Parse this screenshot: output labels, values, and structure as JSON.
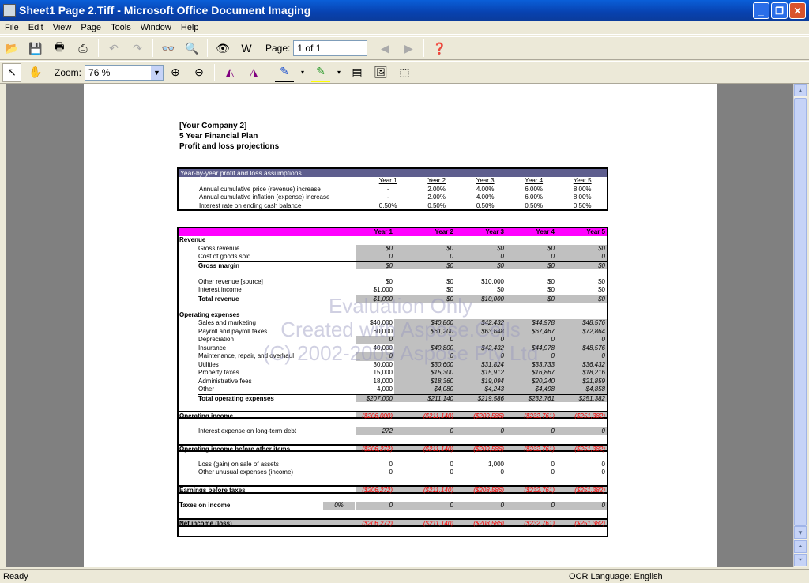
{
  "window": {
    "title": "Sheet1 Page 2.Tiff - Microsoft Office Document Imaging",
    "minimize": "_",
    "maximize": "❐",
    "close": "✕"
  },
  "menu": [
    "File",
    "Edit",
    "View",
    "Page",
    "Tools",
    "Window",
    "Help"
  ],
  "toolbar": {
    "page_label": "Page:",
    "page_value": "1 of 1",
    "zoom_label": "Zoom:",
    "zoom_value": "76 %"
  },
  "status": {
    "left": "Ready",
    "ocr": "OCR Language: English"
  },
  "document": {
    "header": [
      "[Your Company 2]",
      "5 Year Financial Plan",
      "Profit and loss projections"
    ],
    "assumptions": {
      "title": "Year-by-year profit and loss assumptions",
      "years": [
        "Year 1",
        "Year 2",
        "Year 3",
        "Year 4",
        "Year 5"
      ],
      "rows": [
        {
          "label": "Annual cumulative price (revenue) increase",
          "values": [
            "-",
            "2.00%",
            "4.00%",
            "6.00%",
            "8.00%"
          ]
        },
        {
          "label": "Annual cumulative inflation (expense) increase",
          "values": [
            "-",
            "2.00%",
            "4.00%",
            "6.00%",
            "8.00%"
          ]
        },
        {
          "label": "Interest rate on ending cash balance",
          "values": [
            "0.50%",
            "0.50%",
            "0.50%",
            "0.50%",
            "0.50%"
          ]
        }
      ]
    },
    "pl": {
      "years": [
        "Year 1",
        "Year 2",
        "Year 3",
        "Year 4",
        "Year 5"
      ],
      "rows": [
        {
          "kind": "section",
          "label": "Revenue"
        },
        {
          "kind": "shaded",
          "label": "Gross revenue",
          "values": [
            "$0",
            "$0",
            "$0",
            "$0",
            "$0"
          ]
        },
        {
          "kind": "shaded",
          "label": "Cost of goods sold",
          "values": [
            "0",
            "0",
            "0",
            "0",
            "0"
          ]
        },
        {
          "kind": "subtotal",
          "label": "Gross margin",
          "values": [
            "$0",
            "$0",
            "$0",
            "$0",
            "$0"
          ]
        },
        {
          "kind": "blank"
        },
        {
          "kind": "plain",
          "label": "Other revenue [source]",
          "values": [
            "$0",
            "$0",
            "$10,000",
            "$0",
            "$0"
          ]
        },
        {
          "kind": "plain",
          "label": "Interest income",
          "values": [
            "$1,000",
            "$0",
            "$0",
            "$0",
            "$0"
          ]
        },
        {
          "kind": "subtotal",
          "label": "Total revenue",
          "values": [
            "$1,000",
            "$0",
            "$10,000",
            "$0",
            "$0"
          ]
        },
        {
          "kind": "blank"
        },
        {
          "kind": "section",
          "label": "Operating expenses"
        },
        {
          "kind": "input",
          "label": "Sales and marketing",
          "values": [
            "$40,000",
            "$40,800",
            "$42,432",
            "$44,978",
            "$48,576"
          ]
        },
        {
          "kind": "input",
          "label": "Payroll and payroll taxes",
          "values": [
            "60,000",
            "$61,200",
            "$63,648",
            "$67,467",
            "$72,864"
          ]
        },
        {
          "kind": "shaded",
          "label": "Depreciation",
          "values": [
            "0",
            "0",
            "0",
            "0",
            "0"
          ]
        },
        {
          "kind": "input",
          "label": "Insurance",
          "values": [
            "40,000",
            "$40,800",
            "$42,432",
            "$44,978",
            "$48,576"
          ]
        },
        {
          "kind": "shaded",
          "label": "Maintenance, repair, and overhaul",
          "values": [
            "0",
            "0",
            "0",
            "0",
            "0"
          ]
        },
        {
          "kind": "input",
          "label": "Utilities",
          "values": [
            "30,000",
            "$30,600",
            "$31,824",
            "$33,733",
            "$36,432"
          ]
        },
        {
          "kind": "input",
          "label": "Property taxes",
          "values": [
            "15,000",
            "$15,300",
            "$15,912",
            "$16,867",
            "$18,216"
          ]
        },
        {
          "kind": "input",
          "label": "Administrative fees",
          "values": [
            "18,000",
            "$18,360",
            "$19,094",
            "$20,240",
            "$21,859"
          ]
        },
        {
          "kind": "input",
          "label": "Other",
          "values": [
            "4,000",
            "$4,080",
            "$4,243",
            "$4,498",
            "$4,858"
          ]
        },
        {
          "kind": "subtotal",
          "label": "Total operating expenses",
          "values": [
            "$207,000",
            "$211,140",
            "$219,586",
            "$232,761",
            "$251,382"
          ]
        },
        {
          "kind": "blank"
        },
        {
          "kind": "total",
          "label": "Operating income",
          "values": [
            "($206,000)",
            "($211,140)",
            "($209,586)",
            "($232,761)",
            "($251,382)"
          ]
        },
        {
          "kind": "blank"
        },
        {
          "kind": "shaded",
          "label": "Interest expense on long-term debt",
          "values": [
            "272",
            "0",
            "0",
            "0",
            "0"
          ]
        },
        {
          "kind": "blank"
        },
        {
          "kind": "total",
          "label": "Operating income before other items",
          "values": [
            "($206,272)",
            "($211,140)",
            "($209,586)",
            "($232,761)",
            "($251,382)"
          ]
        },
        {
          "kind": "blank"
        },
        {
          "kind": "plain",
          "label": "Loss (gain) on sale of assets",
          "values": [
            "0",
            "0",
            "1,000",
            "0",
            "0"
          ]
        },
        {
          "kind": "plain",
          "label": "Other unusual expenses (income)",
          "values": [
            "0",
            "0",
            "0",
            "0",
            "0"
          ]
        },
        {
          "kind": "blank"
        },
        {
          "kind": "total",
          "label": "Earnings before taxes",
          "values": [
            "($206,272)",
            "($211,140)",
            "($208,586)",
            "($232,761)",
            "($251,382)"
          ]
        },
        {
          "kind": "blank"
        },
        {
          "kind": "tax",
          "label": "Taxes on income",
          "rate": "0%",
          "values": [
            "0",
            "0",
            "0",
            "0",
            "0"
          ]
        },
        {
          "kind": "blank"
        },
        {
          "kind": "net",
          "label": "Net income (loss)",
          "values": [
            "($206,272)",
            "($211,140)",
            "($208,586)",
            "($232,761)",
            "($251,382)"
          ]
        }
      ]
    },
    "watermark": [
      "Evaluation Only",
      "Created with Aspose.Cells",
      "(C) 2002-2009 Aspose Pty Ltd"
    ]
  }
}
